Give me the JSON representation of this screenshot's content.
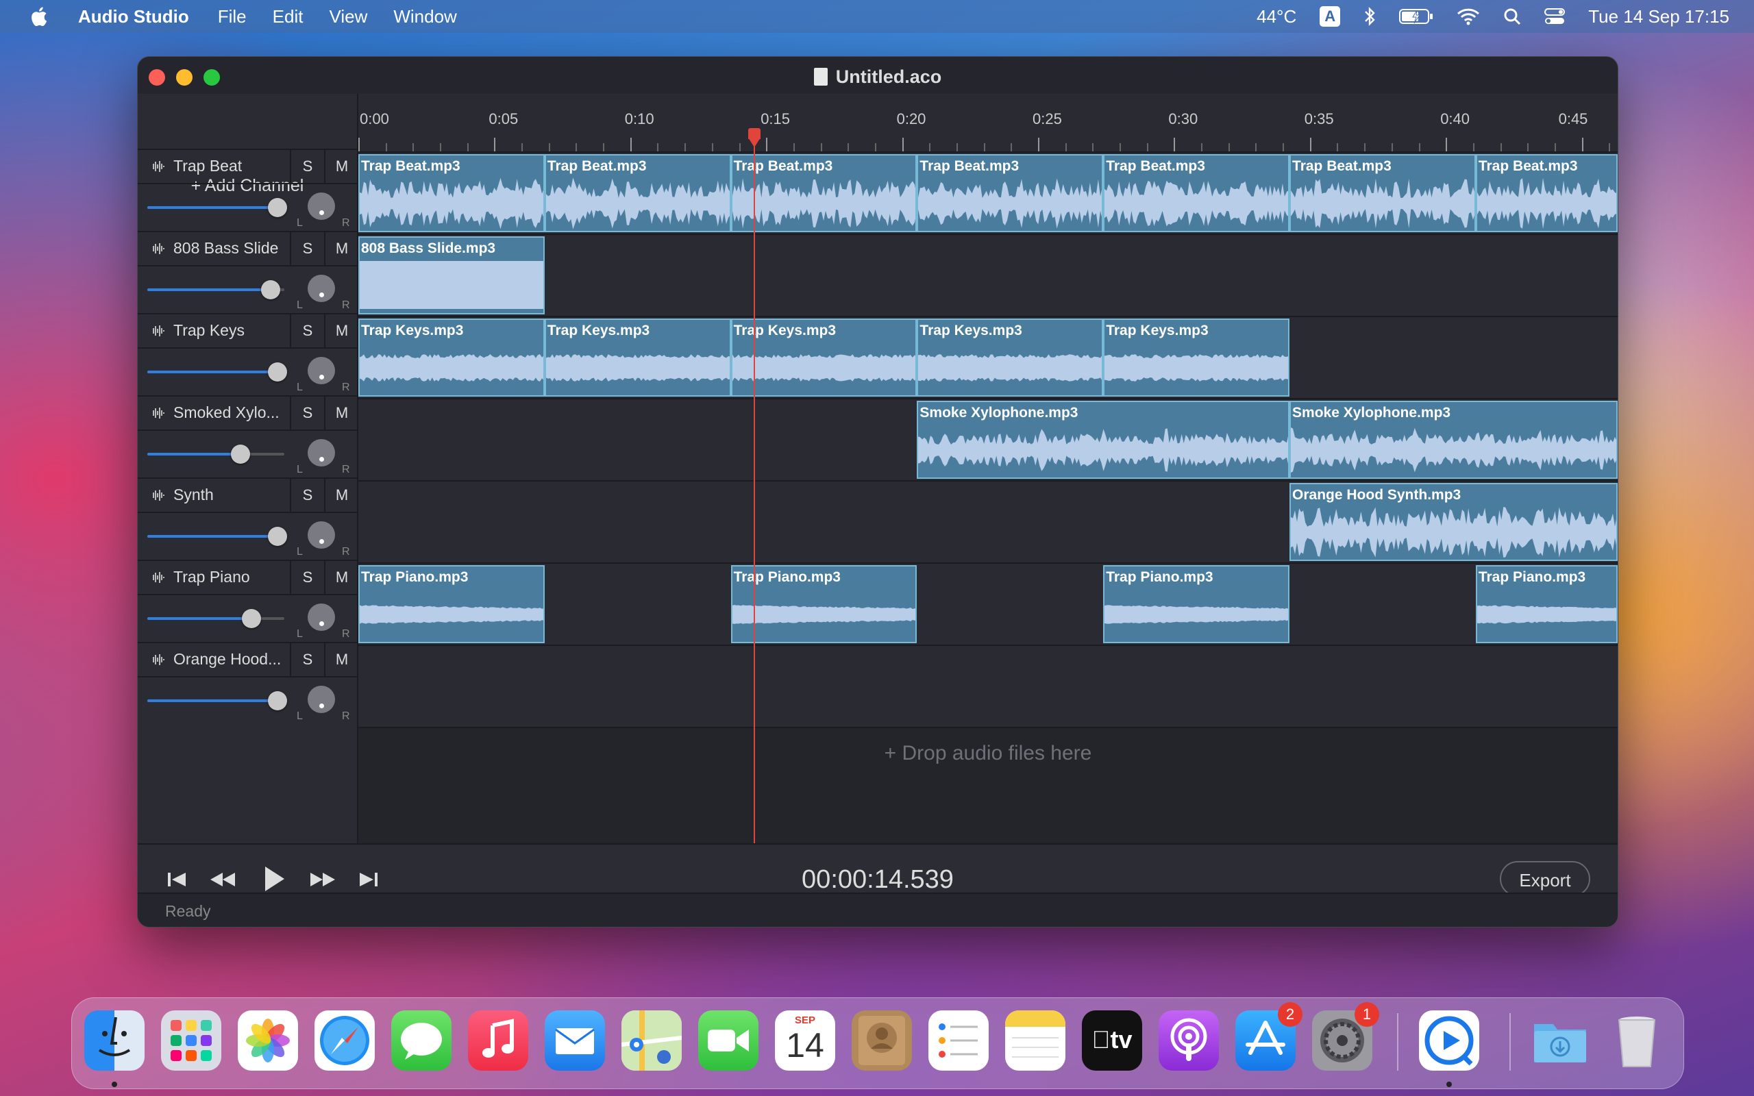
{
  "menubar": {
    "app_name": "Audio Studio",
    "menus": [
      "File",
      "Edit",
      "View",
      "Window"
    ],
    "temperature": "44°C",
    "input_source": "A",
    "datetime": "Tue 14 Sep  17:15"
  },
  "window": {
    "title": "Untitled.aco",
    "add_channel_label": "+ Add Channel",
    "drop_hint": "+ Drop audio files here"
  },
  "timeline": {
    "tick_labels": [
      "0:00",
      "0:05",
      "0:10",
      "0:15",
      "0:20",
      "0:25",
      "0:30",
      "0:35",
      "0:40",
      "0:45"
    ],
    "playhead_seconds": 14.539
  },
  "channels": [
    {
      "name": "Trap Beat",
      "solo": "S",
      "mute": "M",
      "volume": 0.95,
      "pan_l": "L",
      "pan_r": "R",
      "clips": [
        {
          "label": "Trap Beat.mp3",
          "start": 0,
          "len": 6.85
        },
        {
          "label": "Trap Beat.mp3",
          "start": 6.85,
          "len": 6.85
        },
        {
          "label": "Trap Beat.mp3",
          "start": 13.7,
          "len": 6.85
        },
        {
          "label": "Trap Beat.mp3",
          "start": 20.55,
          "len": 6.85
        },
        {
          "label": "Trap Beat.mp3",
          "start": 27.4,
          "len": 6.85
        },
        {
          "label": "Trap Beat.mp3",
          "start": 34.25,
          "len": 6.85
        },
        {
          "label": "Trap Beat.mp3",
          "start": 41.1,
          "len": 5.4
        }
      ],
      "style": "dense"
    },
    {
      "name": "808 Bass Slide",
      "solo": "S",
      "mute": "M",
      "volume": 0.9,
      "pan_l": "L",
      "pan_r": "R",
      "clips": [
        {
          "label": "808 Bass Slide.mp3",
          "start": 0,
          "len": 6.85
        }
      ],
      "style": "flat"
    },
    {
      "name": "Trap Keys",
      "solo": "S",
      "mute": "M",
      "volume": 0.95,
      "pan_l": "L",
      "pan_r": "R",
      "clips": [
        {
          "label": "Trap Keys.mp3",
          "start": 0,
          "len": 6.85
        },
        {
          "label": "Trap Keys.mp3",
          "start": 6.85,
          "len": 6.85
        },
        {
          "label": "Trap Keys.mp3",
          "start": 13.7,
          "len": 6.85
        },
        {
          "label": "Trap Keys.mp3",
          "start": 20.55,
          "len": 6.85
        },
        {
          "label": "Trap Keys.mp3",
          "start": 27.4,
          "len": 6.85
        }
      ],
      "style": "smooth"
    },
    {
      "name": "Smoked Xylo...",
      "solo": "S",
      "mute": "M",
      "volume": 0.68,
      "pan_l": "L",
      "pan_r": "R",
      "clips": [
        {
          "label": "Smoke Xylophone.mp3",
          "start": 20.55,
          "len": 13.7
        },
        {
          "label": "Smoke Xylophone.mp3",
          "start": 34.25,
          "len": 12.25
        }
      ],
      "style": "medium"
    },
    {
      "name": "Synth",
      "solo": "S",
      "mute": "M",
      "volume": 0.95,
      "pan_l": "L",
      "pan_r": "R",
      "clips": [
        {
          "label": "Orange Hood Synth.mp3",
          "start": 34.25,
          "len": 12.25
        }
      ],
      "style": "dense"
    },
    {
      "name": "Trap Piano",
      "solo": "S",
      "mute": "M",
      "volume": 0.76,
      "pan_l": "L",
      "pan_r": "R",
      "clips": [
        {
          "label": "Trap Piano.mp3",
          "start": 0,
          "len": 6.85
        },
        {
          "label": "Trap Piano.mp3",
          "start": 13.7,
          "len": 6.85
        },
        {
          "label": "Trap Piano.mp3",
          "start": 27.4,
          "len": 6.85
        },
        {
          "label": "Trap Piano.mp3",
          "start": 41.1,
          "len": 5.4
        }
      ],
      "style": "decay"
    },
    {
      "name": "Orange Hood...",
      "solo": "S",
      "mute": "M",
      "volume": 0.95,
      "pan_l": "L",
      "pan_r": "R",
      "clips": [],
      "style": "none"
    }
  ],
  "transport": {
    "timecode": "00:00:14.539",
    "export_label": "Export"
  },
  "status": "Ready",
  "dock": {
    "apps": [
      "Finder",
      "Launchpad",
      "Photos",
      "Safari",
      "Messages",
      "Music",
      "Mail",
      "Maps",
      "FaceTime",
      "Calendar",
      "Contacts",
      "Reminders",
      "Notes",
      "TV",
      "Podcasts",
      "App Store",
      "System Preferences",
      "QuickTime Player",
      "Downloads",
      "Trash"
    ],
    "calendar_month": "SEP",
    "calendar_day": "14",
    "tv_label": "tv",
    "badges": {
      "app_store": "2",
      "system_preferences": "1"
    }
  }
}
